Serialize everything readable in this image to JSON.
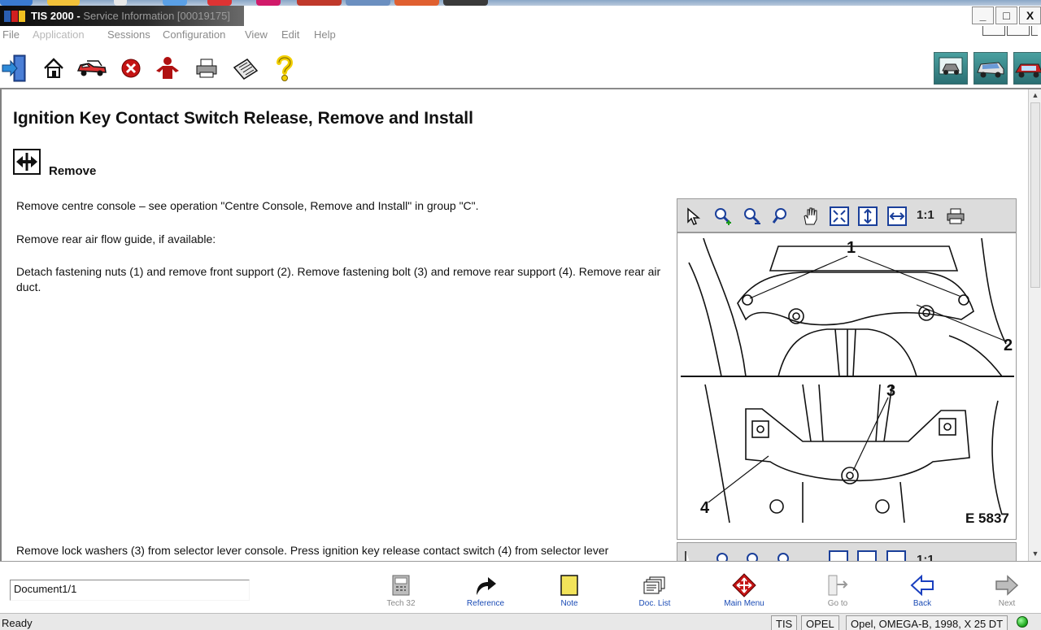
{
  "window": {
    "app_name": "TIS 2000 -",
    "subtitle": "Service Information [00019175]",
    "minimize": "_",
    "maximize": "□",
    "close": "X"
  },
  "menu": {
    "items": [
      "File",
      "Application",
      "Sessions",
      "Configuration",
      "View",
      "Edit",
      "Help"
    ]
  },
  "toolbar": {
    "icons": [
      "exit-icon",
      "home-icon",
      "vehicle-selection-icon",
      "cancel-icon",
      "person-icon",
      "print-icon",
      "notes-icon",
      "help-icon"
    ],
    "right_icons": [
      "application-switch-icon",
      "vehicle-info-icon",
      "car-view-icon"
    ]
  },
  "document": {
    "title": "Ignition Key Contact Switch Release, Remove and Install",
    "section": "Remove",
    "paragraphs": [
      "Remove centre console – see operation \"Centre Console, Remove and Install\" in group \"C\".",
      "Remove rear air flow guide, if available:",
      "Detach fastening nuts (1) and remove front support (2). Remove fastening bolt (3) and remove rear support (4). Remove rear air duct.",
      "Remove lock washers (3) from selector lever console. Press ignition key release contact switch (4) from selector lever"
    ]
  },
  "viewer": {
    "zoom_label": "1:1",
    "tools": [
      "pointer-icon",
      "zoom-in-icon",
      "zoom-out-icon",
      "zoom-icon",
      "pan-hand-icon",
      "fit-window-icon",
      "fit-height-icon",
      "fit-width-icon",
      "print-icon"
    ],
    "figure": {
      "callouts": [
        "1",
        "2",
        "3",
        "4"
      ],
      "code": "E 5837"
    }
  },
  "nav": {
    "document_field": "Document1/1",
    "buttons": [
      {
        "label": "Tech 32",
        "enabled": false
      },
      {
        "label": "Reference",
        "enabled": true
      },
      {
        "label": "Note",
        "enabled": true
      },
      {
        "label": "Doc. List",
        "enabled": true
      },
      {
        "label": "Main Menu",
        "enabled": true
      },
      {
        "label": "Go to",
        "enabled": false
      },
      {
        "label": "Back",
        "enabled": true
      },
      {
        "label": "Next",
        "enabled": false
      }
    ]
  },
  "status": {
    "text": "Ready",
    "cells": [
      "TIS",
      "OPEL",
      "Opel, OMEGA-B, 1998, X 25 DT"
    ],
    "connection_color": "#1faa1f"
  }
}
